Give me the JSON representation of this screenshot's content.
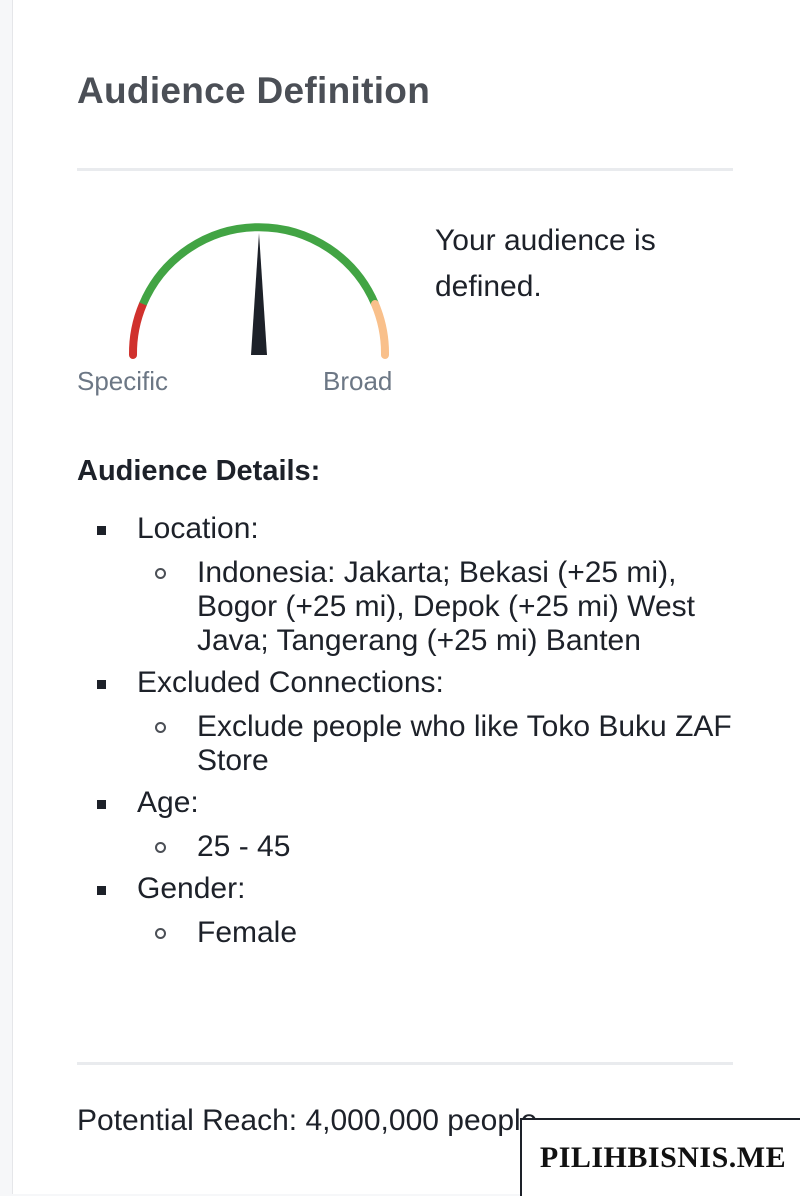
{
  "panel": {
    "title": "Audience Definition",
    "gauge": {
      "specific_label": "Specific",
      "broad_label": "Broad",
      "level": 0.5,
      "colors": {
        "specific": "#d0312d",
        "defined": "#42a444",
        "broad": "#f9c08b",
        "needle": "#1d2129"
      }
    },
    "status_text": "Your audience is defined.",
    "details": {
      "heading": "Audience Details:",
      "location": {
        "label": "Location:",
        "value": "Indonesia: Jakarta; Bekasi (+25 mi), Bogor (+25 mi), Depok (+25 mi) West Java; Tangerang (+25 mi) Banten"
      },
      "excluded": {
        "label": "Excluded Connections:",
        "value": "Exclude people who like Toko Buku ZAF Store"
      },
      "age": {
        "label": "Age:",
        "value": "25 - 45"
      },
      "gender": {
        "label": "Gender:",
        "value": "Female"
      }
    },
    "reach_text": "Potential Reach: 4,000,000 people"
  },
  "watermark": "PILIHBISNIS.ME"
}
